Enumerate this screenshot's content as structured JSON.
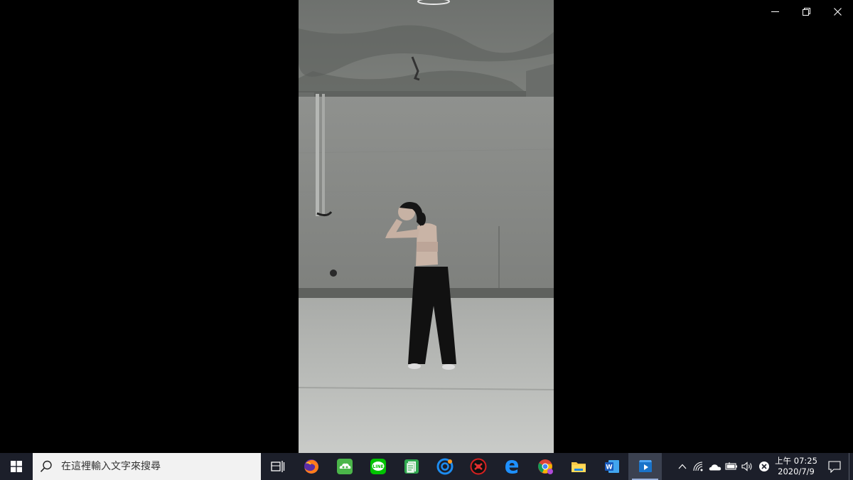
{
  "window": {
    "controls": [
      "minimize",
      "restore",
      "close"
    ]
  },
  "video": {
    "scene": "concrete-room-dancer"
  },
  "taskbar": {
    "search_placeholder": "在這裡輸入文字來搜尋",
    "apps": [
      {
        "name": "task-view",
        "icon": "task-view-icon"
      },
      {
        "name": "firefox",
        "icon": "firefox-icon"
      },
      {
        "name": "app-green-cloud",
        "icon": "green-cloud-icon"
      },
      {
        "name": "line",
        "icon": "line-icon",
        "label": "LINE"
      },
      {
        "name": "green-notes",
        "icon": "notes-icon"
      },
      {
        "name": "blue-circle-app",
        "icon": "blue-c-icon"
      },
      {
        "name": "red-app",
        "icon": "red-circle-icon"
      },
      {
        "name": "edge",
        "icon": "edge-icon"
      },
      {
        "name": "chrome",
        "icon": "chrome-icon"
      },
      {
        "name": "file-explorer",
        "icon": "folder-icon"
      },
      {
        "name": "word",
        "icon": "word-icon",
        "label": "W"
      },
      {
        "name": "video-player",
        "icon": "video-player-icon",
        "active": true
      }
    ],
    "tray": {
      "clock_time": "上午 07:25",
      "clock_date": "2020/7/9"
    }
  },
  "colors": {
    "taskbar": "#1c1f2a",
    "search_bg": "#f2f2f2",
    "active_app": "#3b4150",
    "accent": "#0078d7"
  }
}
